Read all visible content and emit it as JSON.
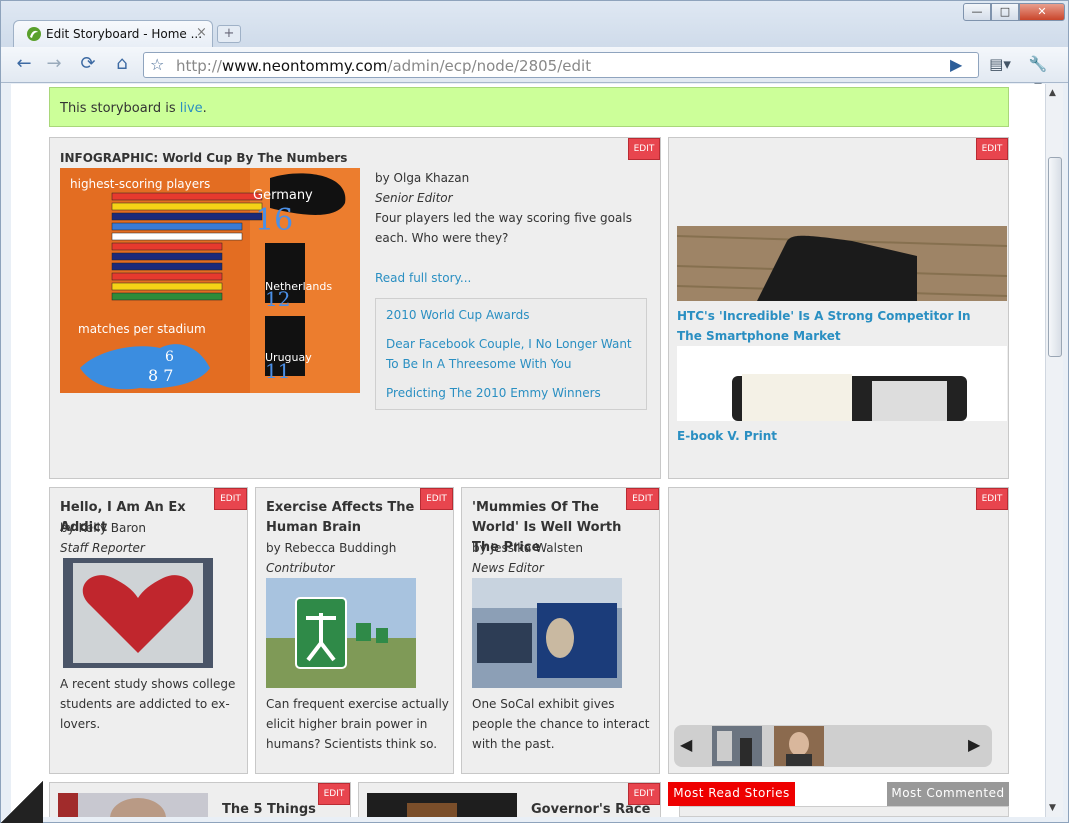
{
  "browser": {
    "tab_title": "Edit Storyboard - Home ...",
    "tab_close": "×",
    "new_tab": "+",
    "url_prefix": "http://",
    "url_host": "www.neontommy.com",
    "url_path": "/admin/ecp/node/2805/edit",
    "win_min": "—",
    "win_max": "□",
    "win_close": "✕"
  },
  "status": {
    "text": "This storyboard is ",
    "link": "live",
    "end": "."
  },
  "edit_label": "EDIT",
  "feature": {
    "title": "INFOGRAPHIC: World Cup By The Numbers",
    "byline": "by Olga Khazan",
    "role": "Senior Editor",
    "teaser": "Four players led the way scoring five goals each. Who were they?",
    "read_more": "Read full story...",
    "related": [
      "2010 World Cup Awards",
      "Dear Facebook Couple, I No Longer Want To Be In A Threesome With You",
      "Predicting The 2010 Emmy Winners"
    ],
    "infographic": {
      "heading1": "highest-scoring players",
      "heading2": "matches per stadium",
      "germany": "Germany",
      "germany_num": "16",
      "netherlands": "Netherlands",
      "netherlands_num": "12",
      "uruguay": "Uruguay",
      "uruguay_num": "11"
    }
  },
  "side": {
    "story1": "HTC's 'Incredible' Is A Strong Competitor In The Smartphone Market",
    "story2": "E-book V. Print"
  },
  "cards": [
    {
      "title": "Hello, I Am An Ex Addict",
      "byline": "by Kelly Baron",
      "role": "Staff Reporter",
      "teaser": "A recent study shows college students are addicted to ex-lovers."
    },
    {
      "title": "Exercise Affects The Human Brain",
      "byline": "by Rebecca Buddingh",
      "role": "Contributor",
      "teaser": "Can frequent exercise actually elicit higher brain power in humans? Scientists think so."
    },
    {
      "title": "'Mummies Of The World' Is Well Worth The Price",
      "byline": "by Jessika Walsten",
      "role": "News Editor",
      "teaser": "One SoCal exhibit gives people the chance to interact with the past."
    }
  ],
  "bottom": {
    "story_a": "The 5 Things",
    "story_b": "Governor's Race",
    "most_read": "Most Read Stories",
    "most_commented": "Most Commented"
  },
  "carousel": {
    "prev": "◀",
    "next": "▶"
  },
  "colors": {
    "status_bg": "#ccff99",
    "edit_red": "#e8454e",
    "link_blue": "#2a8fc2",
    "card_bg": "#eeeeee"
  }
}
